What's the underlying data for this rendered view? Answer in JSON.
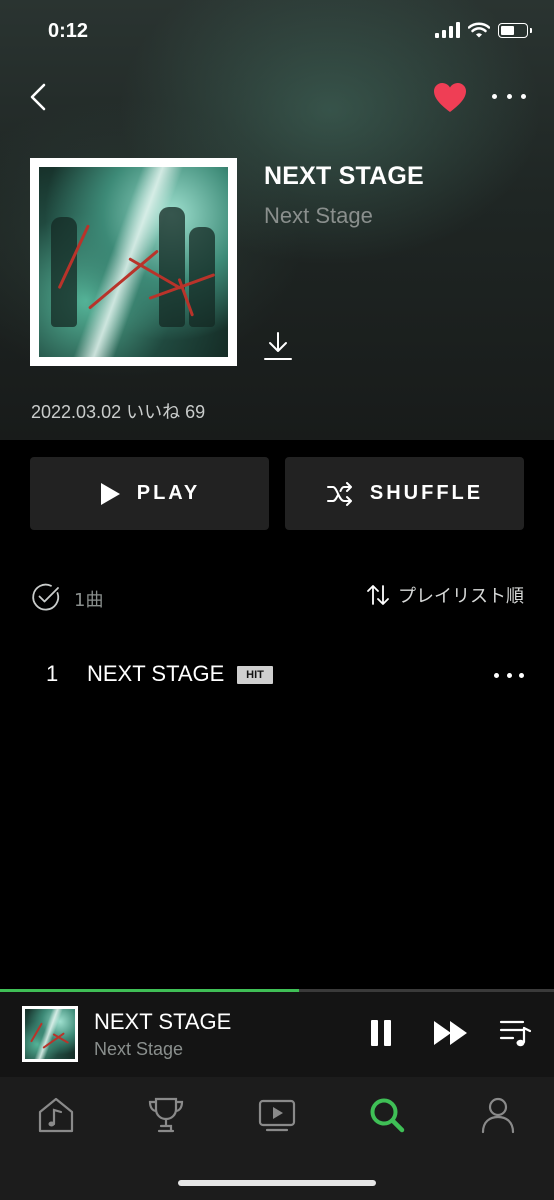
{
  "status_bar": {
    "time": "0:12",
    "battery_level": 0.55
  },
  "header": {
    "back_icon": "chevron-left-icon",
    "favorite_icon": "heart-icon",
    "favorite_color": "#ef3e55",
    "more_icon": "more-horizontal-icon"
  },
  "album": {
    "title": "NEXT STAGE",
    "artist": "Next Stage",
    "meta": "2022.03.02 いいね 69",
    "download_icon": "download-icon"
  },
  "actions": {
    "play_label": "PLAY",
    "play_icon": "play-icon",
    "shuffle_label": "SHUFFLE",
    "shuffle_icon": "shuffle-icon"
  },
  "list_toolbar": {
    "select_icon": "check-circle-icon",
    "track_count": "1曲",
    "sort_icon": "sort-arrows-icon",
    "sort_label": "プレイリスト順"
  },
  "tracks": [
    {
      "number": "1",
      "title": "NEXT STAGE",
      "badge": "HIT"
    }
  ],
  "now_playing": {
    "title": "NEXT STAGE",
    "artist": "Next Stage",
    "progress": 0.54,
    "accent_color": "#3fbf56",
    "controls": [
      "pause-icon",
      "fast-forward-icon",
      "queue-icon"
    ]
  },
  "tab_bar": {
    "tabs": [
      "music-home-icon",
      "trophy-icon",
      "video-play-icon",
      "search-icon",
      "profile-icon"
    ],
    "active_tab": "search-icon",
    "active_color": "#3fbf56"
  }
}
